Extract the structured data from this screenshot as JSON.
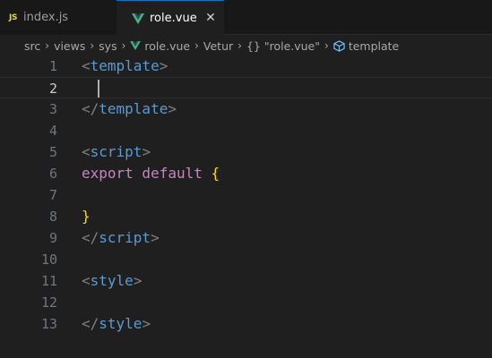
{
  "tabs": [
    {
      "icon": "js-file-icon",
      "icon_text": "JS",
      "label": "index.js",
      "active": false
    },
    {
      "icon": "vue-file-icon",
      "label": "role.vue",
      "active": true,
      "close": "✕"
    }
  ],
  "breadcrumb": {
    "items": [
      "src",
      "views",
      "sys",
      "role.vue",
      "Vetur",
      "{} \"role.vue\"",
      "template"
    ],
    "separator": "›"
  },
  "editor": {
    "current_line": 2,
    "lines": [
      {
        "n": "1",
        "tokens": [
          [
            "<",
            "p"
          ],
          [
            "template",
            "t"
          ],
          [
            ">",
            "p"
          ]
        ]
      },
      {
        "n": "2",
        "tokens": []
      },
      {
        "n": "3",
        "tokens": [
          [
            "</",
            "p"
          ],
          [
            "template",
            "t"
          ],
          [
            ">",
            "p"
          ]
        ]
      },
      {
        "n": "4",
        "tokens": []
      },
      {
        "n": "5",
        "tokens": [
          [
            "<",
            "p"
          ],
          [
            "script",
            "t"
          ],
          [
            ">",
            "p"
          ]
        ]
      },
      {
        "n": "6",
        "tokens": [
          [
            "export default ",
            "k"
          ],
          [
            "{",
            "b"
          ]
        ]
      },
      {
        "n": "7",
        "tokens": []
      },
      {
        "n": "8",
        "tokens": [
          [
            "}",
            "b"
          ]
        ]
      },
      {
        "n": "9",
        "tokens": [
          [
            "</",
            "p"
          ],
          [
            "script",
            "t"
          ],
          [
            ">",
            "p"
          ]
        ]
      },
      {
        "n": "10",
        "tokens": []
      },
      {
        "n": "11",
        "tokens": [
          [
            "<",
            "p"
          ],
          [
            "style",
            "t"
          ],
          [
            ">",
            "p"
          ]
        ]
      },
      {
        "n": "12",
        "tokens": []
      },
      {
        "n": "13",
        "tokens": [
          [
            "</",
            "p"
          ],
          [
            "style",
            "t"
          ],
          [
            ">",
            "p"
          ]
        ]
      }
    ]
  },
  "colors": {
    "background": "#1f1f1f",
    "tag": "#569cd6",
    "punctuation": "#808080",
    "keyword": "#c586c0",
    "brace": "#ffd700",
    "vue_green": "#41b883",
    "js_yellow": "#e8d44d",
    "active_tab_border": "#0078d4"
  }
}
